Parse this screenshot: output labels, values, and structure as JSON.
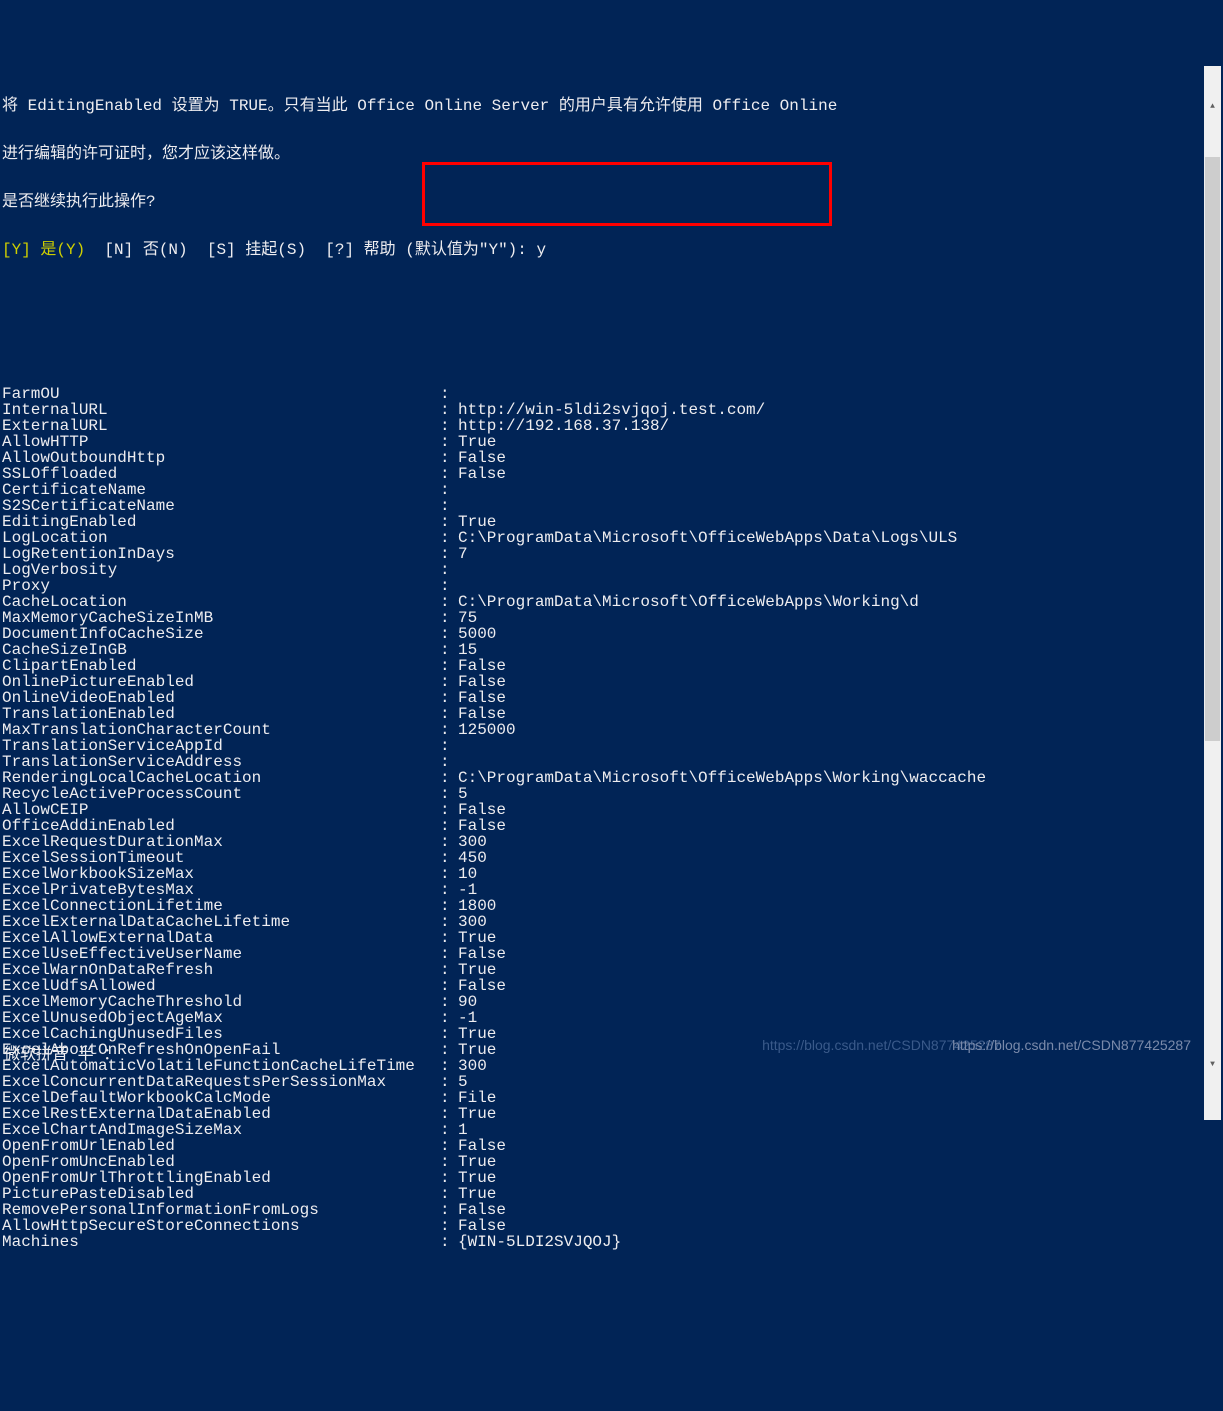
{
  "header": {
    "line1": "将 EditingEnabled 设置为 TRUE。只有当此 Office Online Server 的用户具有允许使用 Office Online",
    "line2": "进行编辑的许可证时，您才应该这样做。",
    "line3": "是否继续执行此操作?",
    "prompt_y": "[Y] 是(Y)",
    "prompt_rest": "  [N] 否(N)  [S] 挂起(S)  [?] 帮助 (默认值为\"Y\"): y"
  },
  "properties": [
    {
      "key": "FarmOU",
      "value": ""
    },
    {
      "key": "InternalURL",
      "value": "http://win-5ldi2svjqoj.test.com/"
    },
    {
      "key": "ExternalURL",
      "value": "http://192.168.37.138/"
    },
    {
      "key": "AllowHTTP",
      "value": "True"
    },
    {
      "key": "AllowOutboundHttp",
      "value": "False"
    },
    {
      "key": "SSLOffloaded",
      "value": "False"
    },
    {
      "key": "CertificateName",
      "value": ""
    },
    {
      "key": "S2SCertificateName",
      "value": ""
    },
    {
      "key": "EditingEnabled",
      "value": "True"
    },
    {
      "key": "LogLocation",
      "value": "C:\\ProgramData\\Microsoft\\OfficeWebApps\\Data\\Logs\\ULS"
    },
    {
      "key": "LogRetentionInDays",
      "value": "7"
    },
    {
      "key": "LogVerbosity",
      "value": ""
    },
    {
      "key": "Proxy",
      "value": ""
    },
    {
      "key": "CacheLocation",
      "value": "C:\\ProgramData\\Microsoft\\OfficeWebApps\\Working\\d"
    },
    {
      "key": "MaxMemoryCacheSizeInMB",
      "value": "75"
    },
    {
      "key": "DocumentInfoCacheSize",
      "value": "5000"
    },
    {
      "key": "CacheSizeInGB",
      "value": "15"
    },
    {
      "key": "ClipartEnabled",
      "value": "False"
    },
    {
      "key": "OnlinePictureEnabled",
      "value": "False"
    },
    {
      "key": "OnlineVideoEnabled",
      "value": "False"
    },
    {
      "key": "TranslationEnabled",
      "value": "False"
    },
    {
      "key": "MaxTranslationCharacterCount",
      "value": "125000"
    },
    {
      "key": "TranslationServiceAppId",
      "value": ""
    },
    {
      "key": "TranslationServiceAddress",
      "value": ""
    },
    {
      "key": "RenderingLocalCacheLocation",
      "value": "C:\\ProgramData\\Microsoft\\OfficeWebApps\\Working\\waccache"
    },
    {
      "key": "RecycleActiveProcessCount",
      "value": "5"
    },
    {
      "key": "AllowCEIP",
      "value": "False"
    },
    {
      "key": "OfficeAddinEnabled",
      "value": "False"
    },
    {
      "key": "ExcelRequestDurationMax",
      "value": "300"
    },
    {
      "key": "ExcelSessionTimeout",
      "value": "450"
    },
    {
      "key": "ExcelWorkbookSizeMax",
      "value": "10"
    },
    {
      "key": "ExcelPrivateBytesMax",
      "value": "-1"
    },
    {
      "key": "ExcelConnectionLifetime",
      "value": "1800"
    },
    {
      "key": "ExcelExternalDataCacheLifetime",
      "value": "300"
    },
    {
      "key": "ExcelAllowExternalData",
      "value": "True"
    },
    {
      "key": "ExcelUseEffectiveUserName",
      "value": "False"
    },
    {
      "key": "ExcelWarnOnDataRefresh",
      "value": "True"
    },
    {
      "key": "ExcelUdfsAllowed",
      "value": "False"
    },
    {
      "key": "ExcelMemoryCacheThreshold",
      "value": "90"
    },
    {
      "key": "ExcelUnusedObjectAgeMax",
      "value": "-1"
    },
    {
      "key": "ExcelCachingUnusedFiles",
      "value": "True"
    },
    {
      "key": "ExcelAbortOnRefreshOnOpenFail",
      "value": "True"
    },
    {
      "key": "ExcelAutomaticVolatileFunctionCacheLifeTime",
      "value": "300"
    },
    {
      "key": "ExcelConcurrentDataRequestsPerSessionMax",
      "value": "5"
    },
    {
      "key": "ExcelDefaultWorkbookCalcMode",
      "value": "File"
    },
    {
      "key": "ExcelRestExternalDataEnabled",
      "value": "True"
    },
    {
      "key": "ExcelChartAndImageSizeMax",
      "value": "1"
    },
    {
      "key": "OpenFromUrlEnabled",
      "value": "False"
    },
    {
      "key": "OpenFromUncEnabled",
      "value": "True"
    },
    {
      "key": "OpenFromUrlThrottlingEnabled",
      "value": "True"
    },
    {
      "key": "PicturePasteDisabled",
      "value": "True"
    },
    {
      "key": "RemovePersonalInformationFromLogs",
      "value": "False"
    },
    {
      "key": "AllowHttpSecureStoreConnections",
      "value": "False"
    },
    {
      "key": "Machines",
      "value": "{WIN-5LDI2SVJQOJ}"
    }
  ],
  "watermark1": "https://blog.csdn.net/CSDN877425287",
  "watermark2": "https://blog.csdn.net/CSDN877425287",
  "ime": "微软拼音 半 ："
}
